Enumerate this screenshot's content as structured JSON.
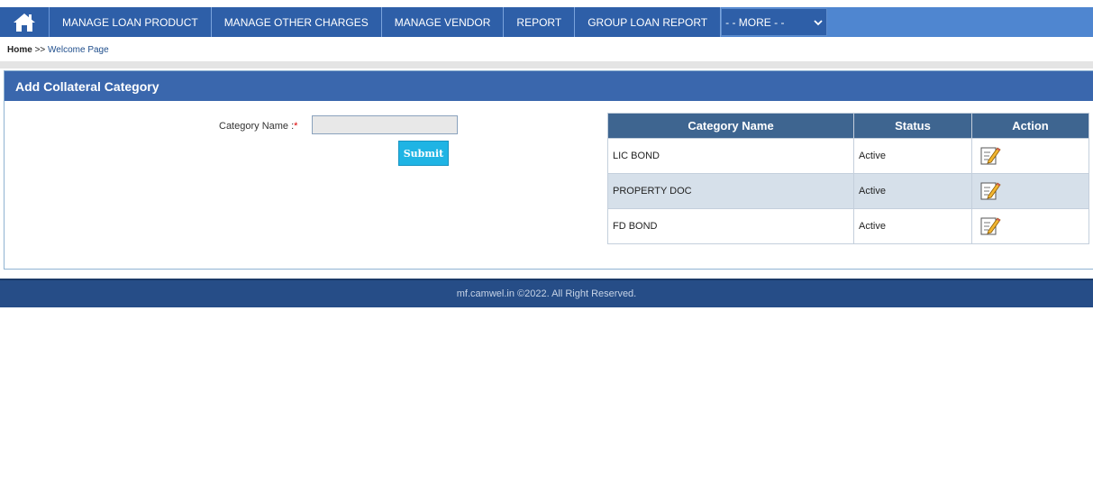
{
  "nav": {
    "items": [
      {
        "label": "MANAGE LOAN PRODUCT"
      },
      {
        "label": "MANAGE OTHER CHARGES"
      },
      {
        "label": "MANAGE VENDOR"
      },
      {
        "label": "REPORT"
      },
      {
        "label": "GROUP LOAN REPORT"
      }
    ],
    "more_select": "- - MORE - -"
  },
  "breadcrumb": {
    "home": "Home",
    "separator": ">>",
    "current": "Welcome Page"
  },
  "panel": {
    "title": "Add Collateral Category"
  },
  "form": {
    "label": "Category Name :",
    "required_mark": "*",
    "input_value": "",
    "submit_label": "Submit"
  },
  "table": {
    "headers": [
      "Category Name",
      "Status",
      "Action"
    ],
    "rows": [
      {
        "name": "LIC BOND",
        "status": "Active"
      },
      {
        "name": "PROPERTY DOC",
        "status": "Active"
      },
      {
        "name": "FD BOND",
        "status": "Active"
      }
    ]
  },
  "footer": {
    "text": "mf.camwel.in ©2022. All Right Reserved."
  },
  "colors": {
    "nav": "#4f86d0",
    "nav_item": "#2e5fa8",
    "panel_header": "#3a67ad",
    "table_header": "#3e6590",
    "submit": "#1fb4e4",
    "footer": "#264d87"
  }
}
